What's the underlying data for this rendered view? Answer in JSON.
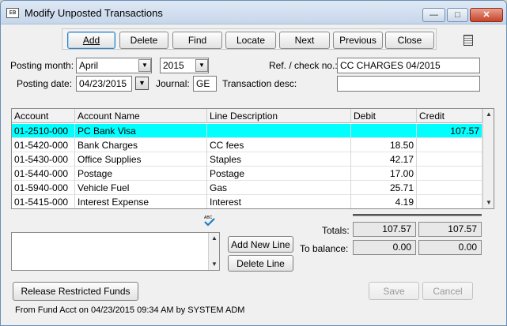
{
  "window": {
    "title": "Modify Unposted Transactions",
    "app_icon": "EB"
  },
  "window_controls": {
    "min": "—",
    "max": "□",
    "close": "✕"
  },
  "toolbar": {
    "add": "Add",
    "delete": "Delete",
    "find": "Find",
    "locate": "Locate",
    "next": "Next",
    "previous": "Previous",
    "close": "Close"
  },
  "header": {
    "posting_month_label": "Posting month:",
    "posting_month": "April",
    "posting_year": "2015",
    "ref_label": "Ref. / check no.:",
    "ref_value": "CC CHARGES 04/2015",
    "posting_date_label": "Posting date:",
    "posting_date": "04/23/2015",
    "journal_label": "Journal:",
    "journal": "GE",
    "trans_desc_label": "Transaction desc:",
    "trans_desc": ""
  },
  "grid": {
    "columns": [
      "Account",
      "Account Name",
      "Line Description",
      "Debit",
      "Credit"
    ],
    "rows": [
      {
        "account": "01-2510-000",
        "name": "PC Bank Visa",
        "desc": "",
        "debit": "",
        "credit": "107.57"
      },
      {
        "account": "01-5420-000",
        "name": "Bank Charges",
        "desc": "CC fees",
        "debit": "18.50",
        "credit": ""
      },
      {
        "account": "01-5430-000",
        "name": "Office Supplies",
        "desc": "Staples",
        "debit": "42.17",
        "credit": ""
      },
      {
        "account": "01-5440-000",
        "name": "Postage",
        "desc": "Postage",
        "debit": "17.00",
        "credit": ""
      },
      {
        "account": "01-5940-000",
        "name": "Vehicle Fuel",
        "desc": "Gas",
        "debit": "25.71",
        "credit": ""
      },
      {
        "account": "01-5415-000",
        "name": "Interest Expense",
        "desc": "Interest",
        "debit": "4.19",
        "credit": ""
      }
    ]
  },
  "spell": {
    "label": "ABC"
  },
  "lines": {
    "add_new_line": "Add New Line",
    "delete_line": "Delete Line"
  },
  "totals": {
    "totals_label": "Totals:",
    "total_debit": "107.57",
    "total_credit": "107.57",
    "balance_label": "To balance:",
    "balance_debit": "0.00",
    "balance_credit": "0.00"
  },
  "actions": {
    "release": "Release Restricted Funds",
    "save": "Save",
    "cancel": "Cancel"
  },
  "footer": {
    "text": "From Fund Acct on 04/23/2015 09:34 AM by SYSTEM ADM"
  },
  "icons": {
    "dropdown": "▼",
    "scroll_up": "▲",
    "scroll_down": "▼"
  }
}
